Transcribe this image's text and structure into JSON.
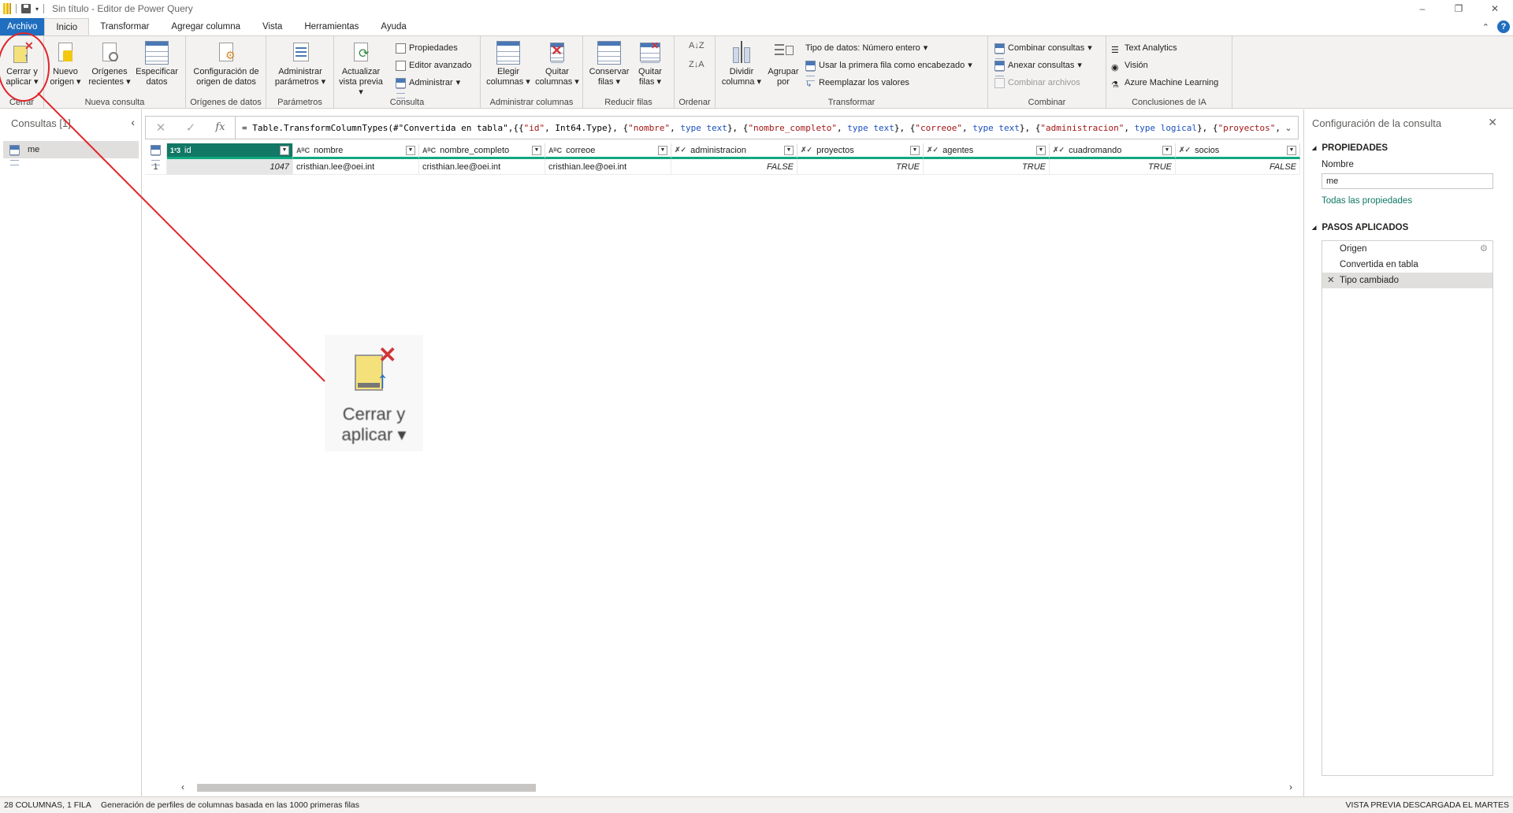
{
  "window": {
    "title": "Sin título - Editor de Power Query",
    "controls": [
      "–",
      "❐",
      "✕"
    ]
  },
  "tabs": [
    {
      "label": "Archivo"
    },
    {
      "label": "Inicio"
    },
    {
      "label": "Transformar"
    },
    {
      "label": "Agregar columna"
    },
    {
      "label": "Vista"
    },
    {
      "label": "Herramientas"
    },
    {
      "label": "Ayuda"
    }
  ],
  "ribbon": {
    "close_apply": "Cerrar y aplicar",
    "group_close": "Cerrar",
    "new_source": "Nuevo origen",
    "recent_sources": "Orígenes recientes",
    "enter_data": "Especificar datos",
    "group_new_query": "Nueva consulta",
    "ds_settings": "Configuración de origen de datos",
    "group_data_sources": "Orígenes de datos",
    "manage_params": "Administrar parámetros",
    "group_params": "Parámetros",
    "refresh_preview": "Actualizar vista previa",
    "properties": "Propiedades",
    "advanced_editor": "Editor avanzado",
    "manage": "Administrar",
    "group_query": "Consulta",
    "choose_cols": "Elegir columnas",
    "remove_cols": "Quitar columnas",
    "group_manage_cols": "Administrar columnas",
    "keep_rows": "Conservar filas",
    "remove_rows": "Quitar filas",
    "group_reduce_rows": "Reducir filas",
    "group_sort": "Ordenar",
    "split_column": "Dividir columna",
    "group_by": "Agrupar por",
    "data_type": "Tipo de datos: Número entero",
    "first_row_header": "Usar la primera fila como encabezado",
    "replace_values": "Reemplazar los valores",
    "group_transform": "Transformar",
    "merge_queries": "Combinar consultas",
    "append_queries": "Anexar consultas",
    "combine_files": "Combinar archivos",
    "group_combine": "Combinar",
    "text_analytics": "Text Analytics",
    "vision": "Visión",
    "azure_ml": "Azure Machine Learning",
    "group_ai": "Conclusiones de IA"
  },
  "queries_pane": {
    "title": "Consultas [1]",
    "items": [
      {
        "name": "me"
      }
    ]
  },
  "formula": {
    "prefix": "= Table.TransformColumnTypes(#\"Convertida en tabla\",{{",
    "parts": [
      {
        "t": "str",
        "v": "\"id\""
      },
      {
        "t": "txt",
        "v": ", Int64.Type}, {"
      },
      {
        "t": "str",
        "v": "\"nombre\""
      },
      {
        "t": "txt",
        "v": ", "
      },
      {
        "t": "kw",
        "v": "type text"
      },
      {
        "t": "txt",
        "v": "}, {"
      },
      {
        "t": "str",
        "v": "\"nombre_completo\""
      },
      {
        "t": "txt",
        "v": ", "
      },
      {
        "t": "kw",
        "v": "type text"
      },
      {
        "t": "txt",
        "v": "}, {"
      },
      {
        "t": "str",
        "v": "\"correoe\""
      },
      {
        "t": "txt",
        "v": ", "
      },
      {
        "t": "kw",
        "v": "type text"
      },
      {
        "t": "txt",
        "v": "}, {"
      },
      {
        "t": "str",
        "v": "\"administracion\""
      },
      {
        "t": "txt",
        "v": ", "
      },
      {
        "t": "kw",
        "v": "type logical"
      },
      {
        "t": "txt",
        "v": "}, {"
      },
      {
        "t": "str",
        "v": "\"proyectos\""
      },
      {
        "t": "txt",
        "v": ","
      }
    ]
  },
  "table": {
    "columns": [
      {
        "name": "id",
        "type": "1²3",
        "width": 160,
        "selected": true
      },
      {
        "name": "nombre",
        "type": "AᴮC",
        "width": 160
      },
      {
        "name": "nombre_completo",
        "type": "AᴮC",
        "width": 160
      },
      {
        "name": "correoe",
        "type": "AᴮC",
        "width": 160
      },
      {
        "name": "administracion",
        "type": "✗✓",
        "width": 160
      },
      {
        "name": "proyectos",
        "type": "✗✓",
        "width": 160
      },
      {
        "name": "agentes",
        "type": "✗✓",
        "width": 160
      },
      {
        "name": "cuadromando",
        "type": "✗✓",
        "width": 160
      },
      {
        "name": "socios",
        "type": "✗✓",
        "width": 158
      }
    ],
    "rows": [
      {
        "n": "1",
        "cells": [
          "1047",
          "cristhian.lee@oei.int",
          "cristhian.lee@oei.int",
          "cristhian.lee@oei.int",
          "FALSE",
          "TRUE",
          "TRUE",
          "TRUE",
          "FALSE"
        ]
      }
    ]
  },
  "settings_pane": {
    "title": "Configuración de la consulta",
    "properties": "PROPIEDADES",
    "name_label": "Nombre",
    "name_value": "me",
    "all_props": "Todas las propiedades",
    "applied_steps": "PASOS APLICADOS",
    "steps": [
      {
        "label": "Origen"
      },
      {
        "label": "Convertida en tabla"
      },
      {
        "label": "Tipo cambiado"
      }
    ]
  },
  "status": {
    "cols_rows": "28 COLUMNAS, 1 FILA",
    "profiling": "Generación de perfiles de columnas basada en las 1000 primeras filas",
    "preview": "VISTA PREVIA DESCARGADA EL MARTES"
  },
  "zoom_callout": {
    "label_line1": "Cerrar y",
    "label_line2": "aplicar ▾"
  },
  "colors": {
    "accent": "#117865",
    "file_tab": "#1f6ebf",
    "annotation": "#e0262b"
  }
}
